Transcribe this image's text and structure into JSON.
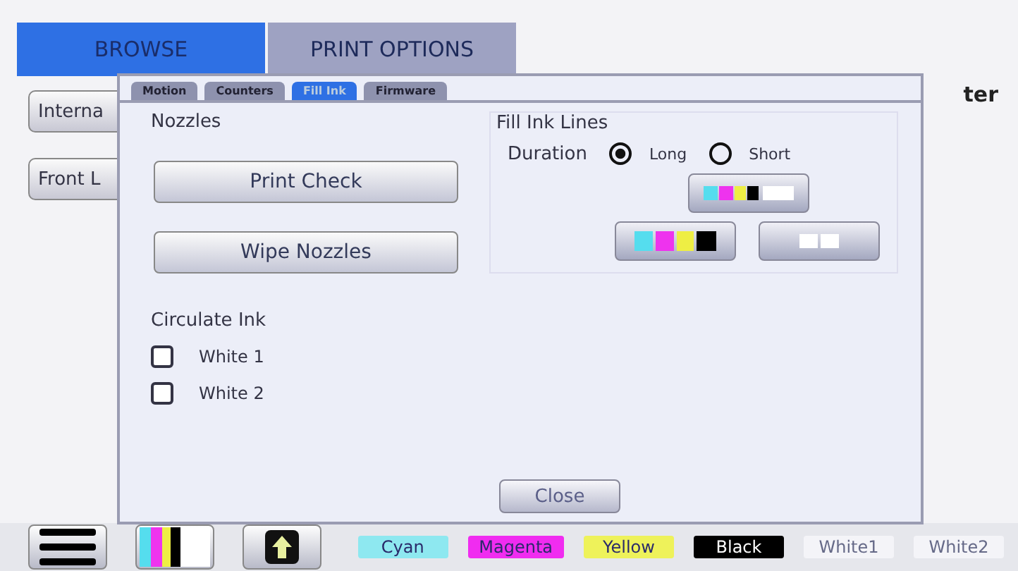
{
  "main_tabs": [
    {
      "label": "BROWSE",
      "selected": true
    },
    {
      "label": "PRINT OPTIONS",
      "selected": false
    }
  ],
  "header_title": "ter",
  "side_buttons": [
    "Interna",
    "Front L"
  ],
  "dialog": {
    "tabs": [
      {
        "label": "Motion",
        "selected": false
      },
      {
        "label": "Counters",
        "selected": false
      },
      {
        "label": "Fill Ink",
        "selected": true
      },
      {
        "label": "Firmware",
        "selected": false
      }
    ],
    "nozzles": {
      "title": "Nozzles",
      "buttons": [
        "Print Check",
        "Wipe Nozzles"
      ]
    },
    "fill_ink_lines": {
      "title": "Fill Ink Lines",
      "duration_label": "Duration",
      "options": [
        {
          "label": "Long",
          "selected": true
        },
        {
          "label": "Short",
          "selected": false
        }
      ]
    },
    "circulate_ink": {
      "title": "Circulate Ink",
      "items": [
        {
          "label": "White 1",
          "checked": false
        },
        {
          "label": "White 2",
          "checked": false
        }
      ]
    },
    "close_button": "Close"
  },
  "inks": [
    {
      "label": "Cyan",
      "color": "#8ee8f0"
    },
    {
      "label": "Magenta",
      "color": "#f02cf0"
    },
    {
      "label": "Yellow",
      "color": "#eef25a"
    },
    {
      "label": "Black",
      "color": "#000000"
    },
    {
      "label": "White1",
      "color": "#f4f4f8"
    },
    {
      "label": "White2",
      "color": "#f4f4f8"
    }
  ]
}
